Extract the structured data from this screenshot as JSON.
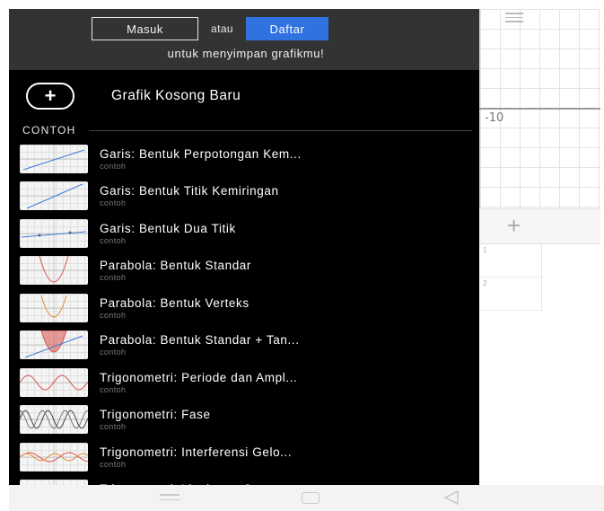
{
  "auth": {
    "login_label": "Masuk",
    "or_label": "atau",
    "signup_label": "Daftar",
    "save_message": "untuk menyimpan grafikmu!"
  },
  "new_graph": {
    "label": "Grafik Kosong Baru",
    "plus_glyph": "+"
  },
  "examples_section": {
    "label": "CONTOH"
  },
  "examples": [
    {
      "title": "Garis: Bentuk Perpotongan Kem...",
      "subtitle": "contoh",
      "thumb": "line-rising"
    },
    {
      "title": "Garis: Bentuk Titik Kemiringan",
      "subtitle": "contoh",
      "thumb": "line-rising-steep"
    },
    {
      "title": "Garis: Bentuk Dua Titik",
      "subtitle": "contoh",
      "thumb": "line-flat"
    },
    {
      "title": "Parabola: Bentuk Standar",
      "subtitle": "contoh",
      "thumb": "parabola"
    },
    {
      "title": "Parabola: Bentuk Verteks",
      "subtitle": "contoh",
      "thumb": "parabola-vertex"
    },
    {
      "title": "Parabola: Bentuk Standar + Tan...",
      "subtitle": "contoh",
      "thumb": "parabola-filled"
    },
    {
      "title": "Trigonometri: Periode dan Ampl...",
      "subtitle": "contoh",
      "thumb": "sine"
    },
    {
      "title": "Trigonometri: Fase",
      "subtitle": "contoh",
      "thumb": "sine-phase"
    },
    {
      "title": "Trigonometri: Interferensi Gelo...",
      "subtitle": "contoh",
      "thumb": "sine-interference"
    },
    {
      "title": "Trigonometri: Lingkaran Satuan",
      "subtitle": "contoh",
      "thumb": "unit-circle"
    }
  ],
  "background_graph": {
    "tick_label": "-10",
    "add_glyph": "+",
    "row_numbers": [
      "1",
      "2"
    ]
  },
  "colors": {
    "drawer_bg": "#000000",
    "header_bg": "#333333",
    "signup_blue": "#2f72e0",
    "thumb_red": "#d9534f",
    "thumb_blue": "#3b7dd8",
    "thumb_green": "#3a9a4a",
    "thumb_orange": "#e08a2e"
  }
}
